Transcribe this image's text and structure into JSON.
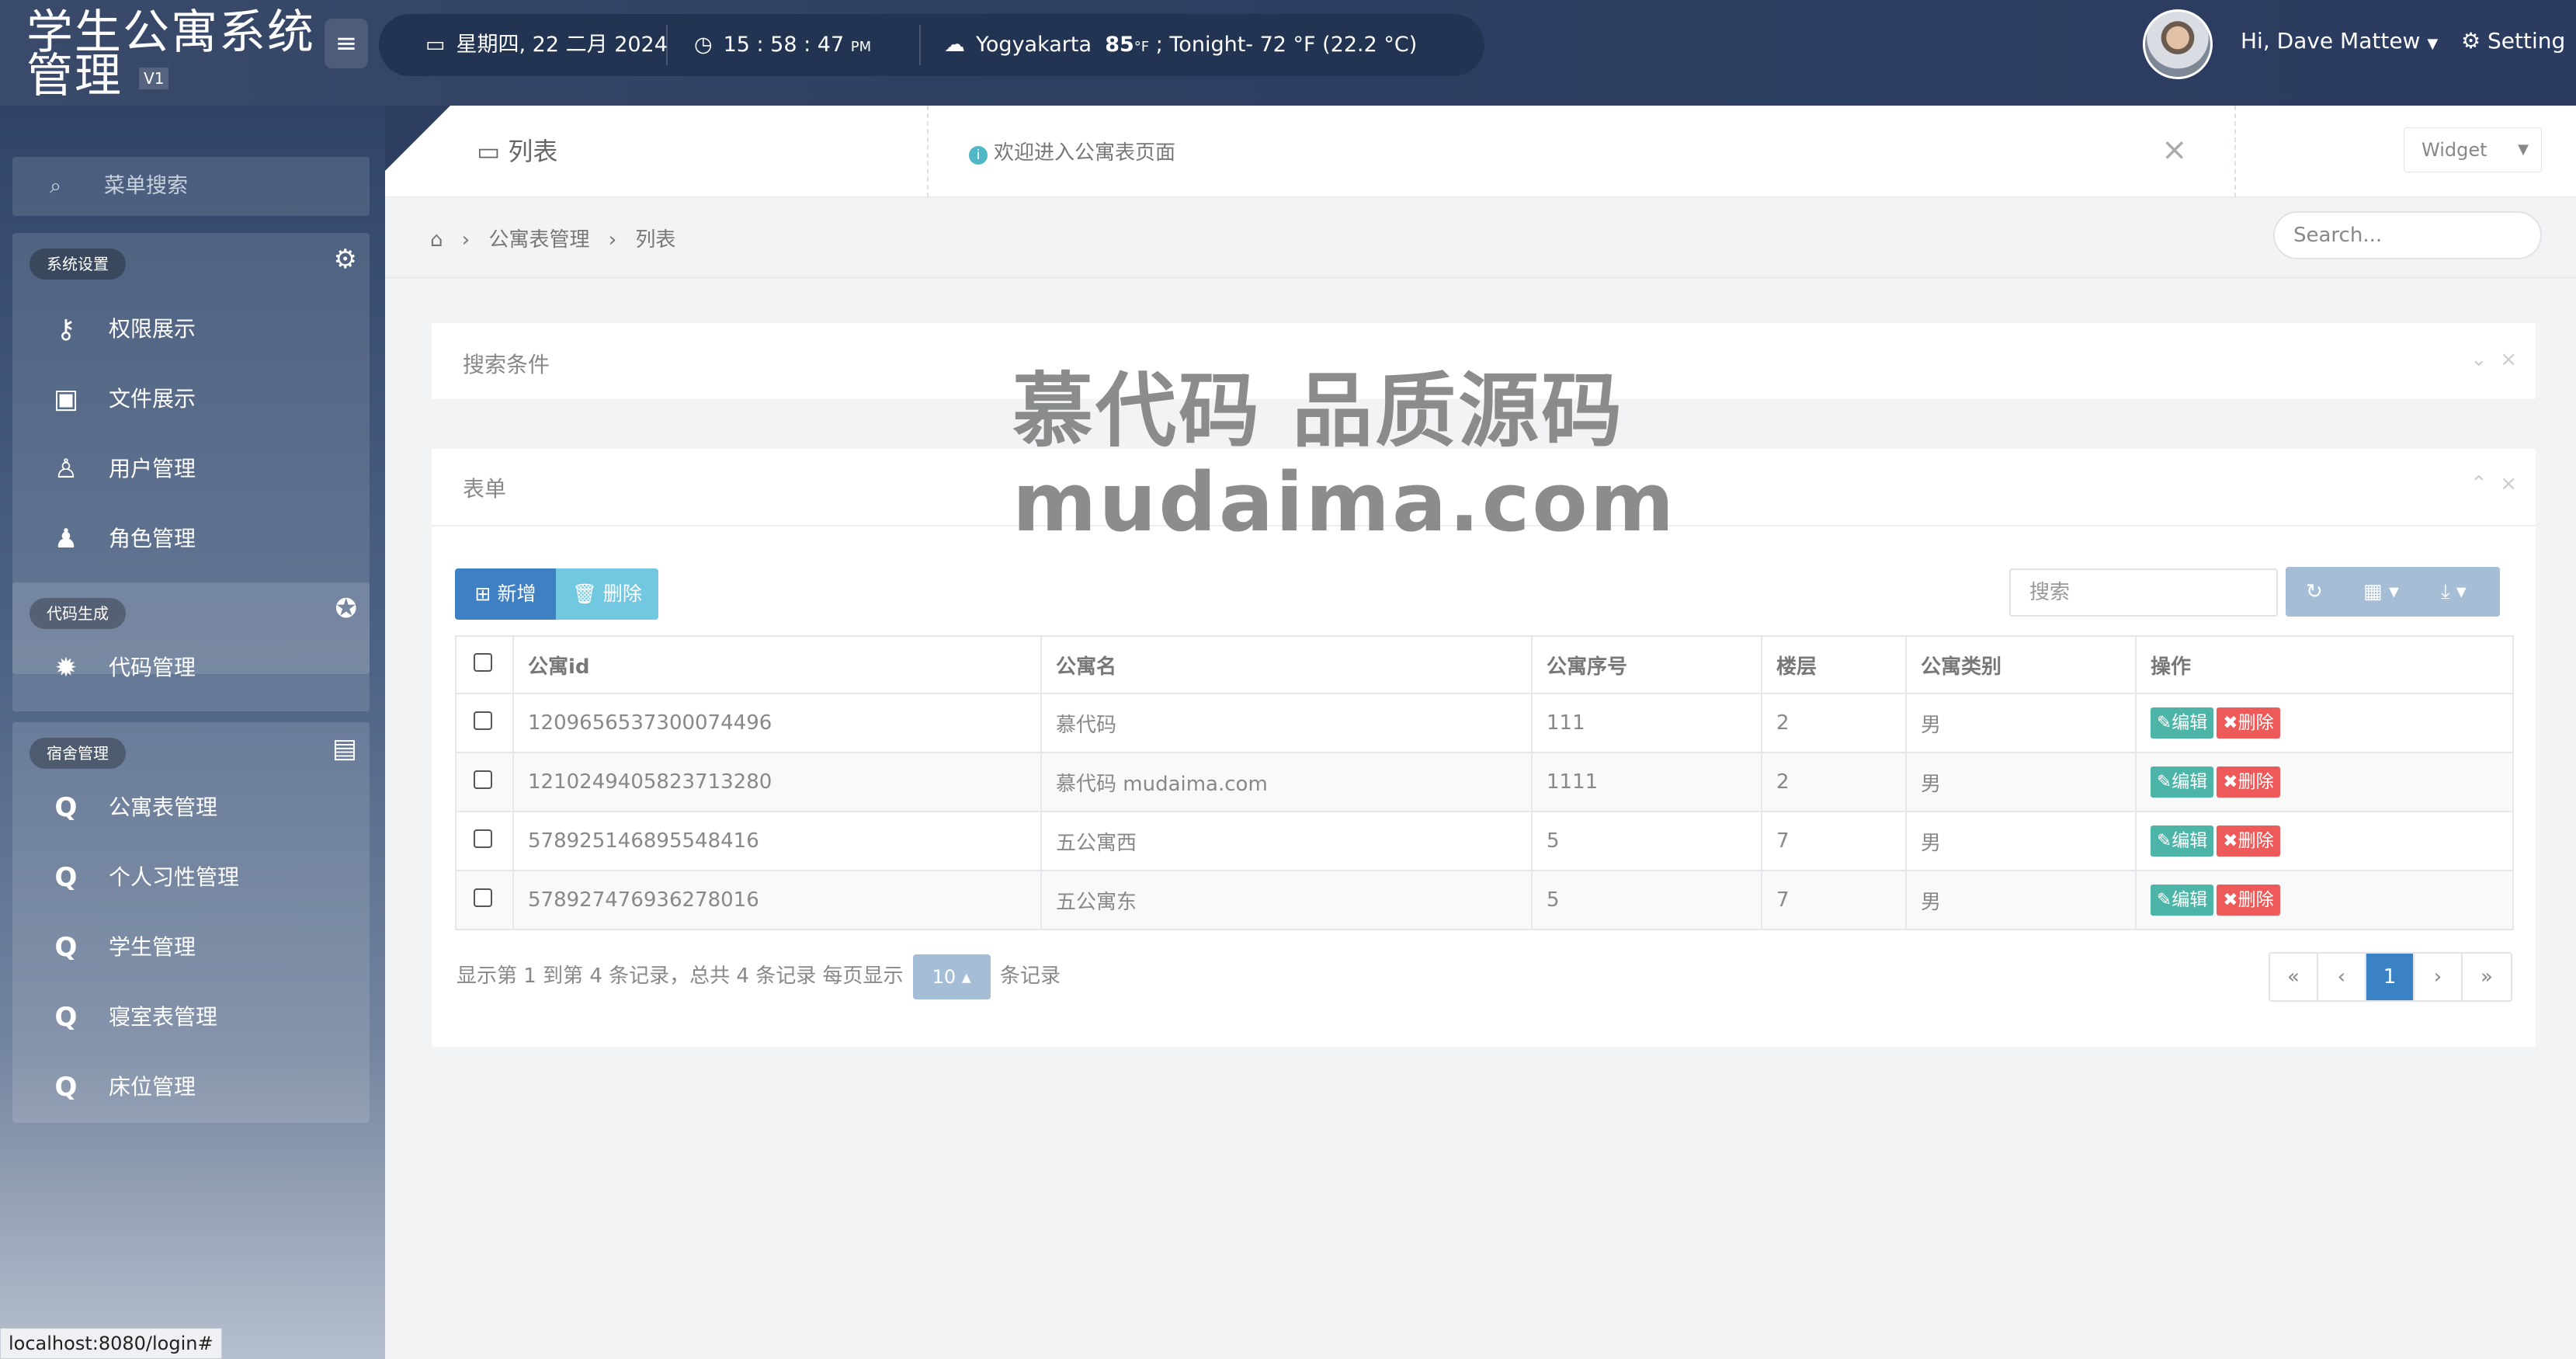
{
  "app": {
    "title": "学生公寓系统管理",
    "version": "V1",
    "menu_icon": "hamburger-icon"
  },
  "infobar": {
    "date": "星期四, 22 二月 2024",
    "time": "15 : 58 : 47",
    "time_suffix": "PM",
    "weather_city": "Yogyakarta",
    "weather_temp": "85",
    "weather_unit": "°F",
    "weather_rest": " ; Tonight- 72 °F (22.2 °C)"
  },
  "user": {
    "greeting": "Hi, Dave Mattew",
    "setting": "Setting"
  },
  "sidebar": {
    "search": "菜单搜索",
    "groups": [
      {
        "title": "系统设置",
        "icon": "gear-icon",
        "items": [
          {
            "label": "权限展示",
            "icon": "key-icon"
          },
          {
            "label": "文件展示",
            "icon": "image-icon"
          },
          {
            "label": "用户管理",
            "icon": "user-icon"
          },
          {
            "label": "角色管理",
            "icon": "users-icon"
          }
        ]
      },
      {
        "title": "代码生成",
        "icon": "rebel-icon",
        "items": [
          {
            "label": "代码管理",
            "icon": "bug-icon"
          }
        ]
      },
      {
        "title": "宿舍管理",
        "icon": "contact-card-icon",
        "items": [
          {
            "label": "公寓表管理",
            "icon": "q-icon"
          },
          {
            "label": "个人习性管理",
            "icon": "q-icon"
          },
          {
            "label": "学生管理",
            "icon": "q-icon"
          },
          {
            "label": "寝室表管理",
            "icon": "q-icon"
          },
          {
            "label": "床位管理",
            "icon": "q-icon"
          }
        ]
      }
    ]
  },
  "header": {
    "page_title": "列表",
    "welcome": "欢迎进入公寓表页面",
    "widget": "Widget",
    "search_placeholder": "Search..."
  },
  "breadcrumb": [
    "公寓表管理",
    "列表"
  ],
  "search_panel": {
    "title": "搜索条件"
  },
  "form_panel": {
    "title": "表单",
    "add_label": "新增",
    "delete_label": "删除",
    "search_placeholder": "搜索",
    "columns": [
      "公寓id",
      "公寓名",
      "公寓序号",
      "楼层",
      "公寓类别",
      "操作"
    ],
    "rows": [
      {
        "id": "1209656537300074496",
        "name": "慕代码",
        "no": "111",
        "floor": "2",
        "type": "男"
      },
      {
        "id": "1210249405823713280",
        "name": "慕代码 mudaima.com",
        "no": "1111",
        "floor": "2",
        "type": "男"
      },
      {
        "id": "578925146895548416",
        "name": "五公寓西",
        "no": "5",
        "floor": "7",
        "type": "男"
      },
      {
        "id": "578927476936278016",
        "name": "五公寓东",
        "no": "5",
        "floor": "7",
        "type": "男"
      }
    ],
    "edit_label": "编辑",
    "row_delete_label": "删除",
    "footer_prefix": "显示第 1 到第 4 条记录，总共 4 条记录 每页显示",
    "page_size": "10",
    "footer_suffix": "条记录",
    "pager": [
      "«",
      "‹",
      "1",
      "›",
      "»"
    ]
  },
  "watermark": {
    "line1": "慕代码 品质源码",
    "line2": "mudaima.com"
  },
  "statusbar": "localhost:8080/login#"
}
